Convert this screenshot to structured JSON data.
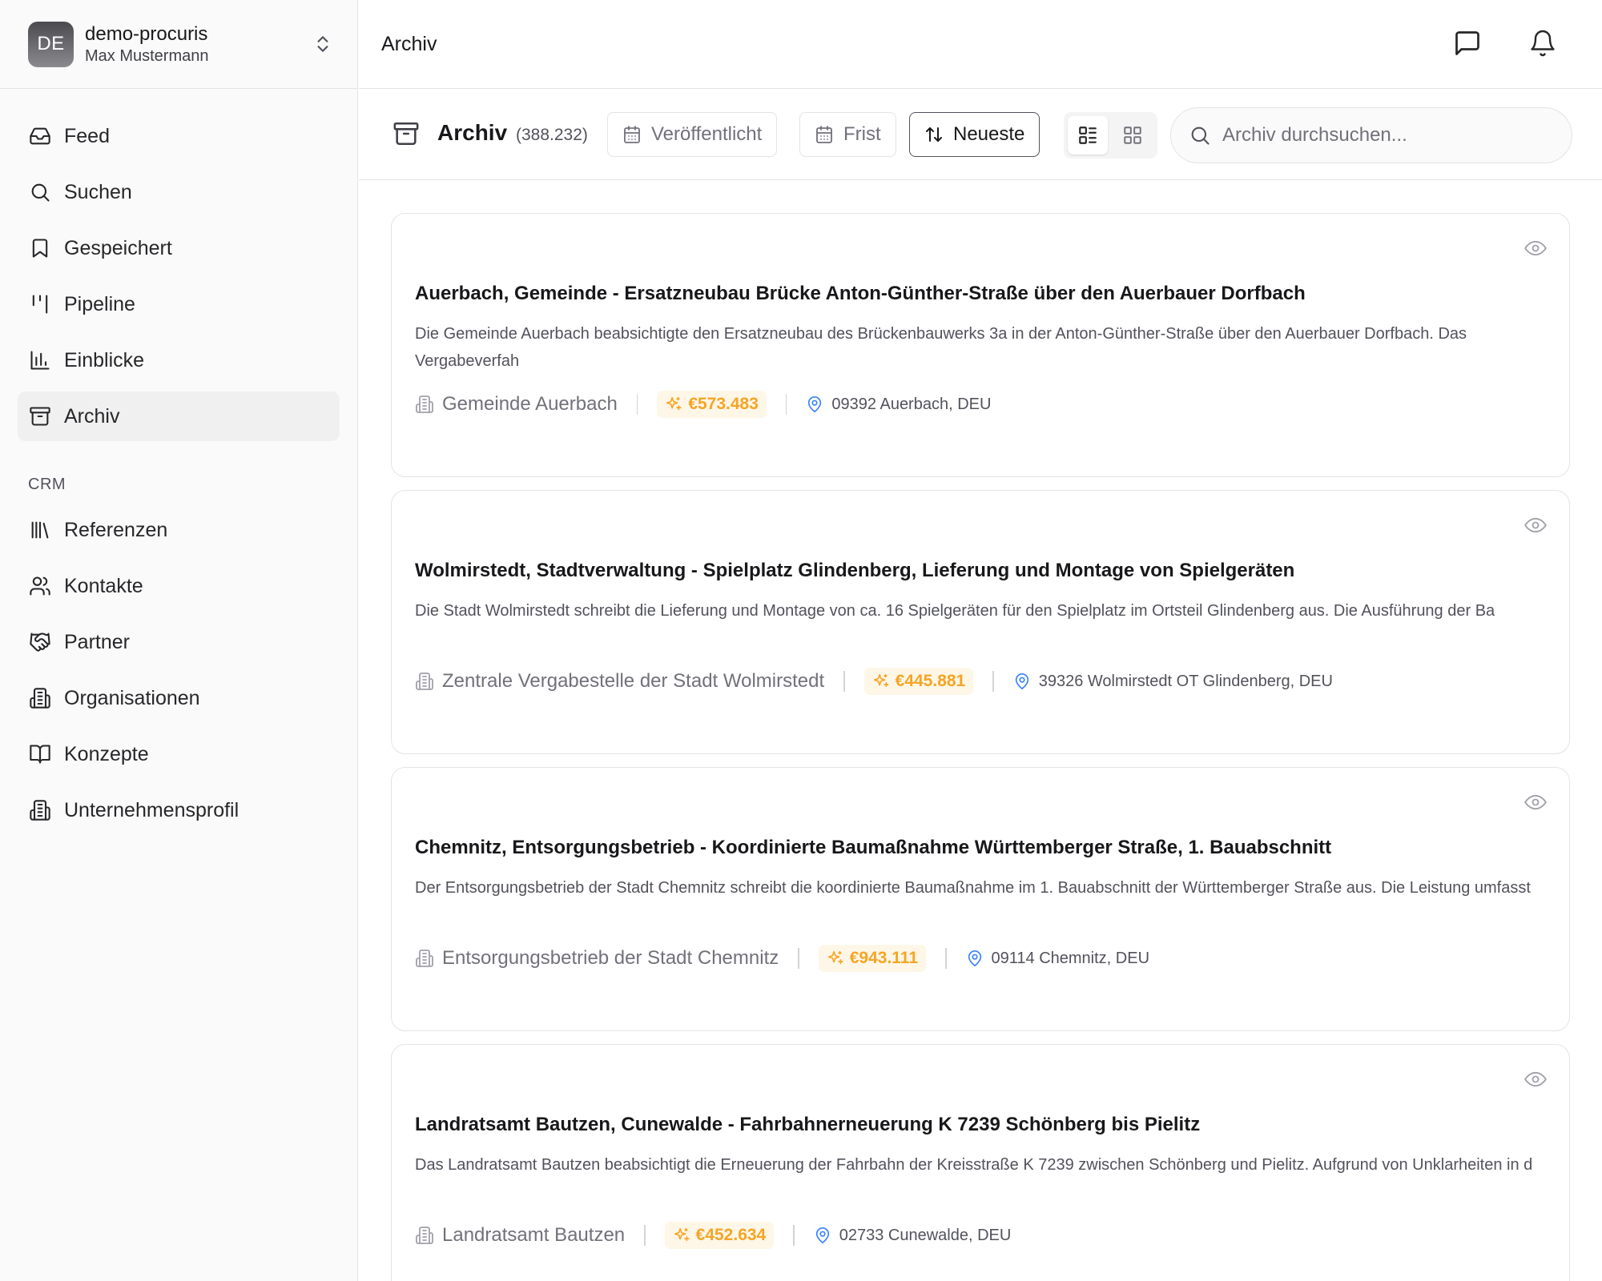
{
  "account": {
    "initials": "DE",
    "workspace": "demo-procuris",
    "user": "Max Mustermann"
  },
  "nav": [
    {
      "label": "Feed",
      "icon": "inbox-icon"
    },
    {
      "label": "Suchen",
      "icon": "search-icon"
    },
    {
      "label": "Gespeichert",
      "icon": "bookmark-icon"
    },
    {
      "label": "Pipeline",
      "icon": "kanban-icon"
    },
    {
      "label": "Einblicke",
      "icon": "bar-chart-icon"
    },
    {
      "label": "Archiv",
      "icon": "archive-icon",
      "active": true
    }
  ],
  "crm": {
    "section_label": "CRM",
    "items": [
      {
        "label": "Referenzen",
        "icon": "library-icon"
      },
      {
        "label": "Kontakte",
        "icon": "users-icon"
      },
      {
        "label": "Partner",
        "icon": "handshake-icon"
      },
      {
        "label": "Organisationen",
        "icon": "building-icon"
      },
      {
        "label": "Konzepte",
        "icon": "book-open-icon"
      },
      {
        "label": "Unternehmensprofil",
        "icon": "building-icon"
      }
    ]
  },
  "topbar": {
    "title": "Archiv",
    "icons": [
      "message-square-icon",
      "bell-icon"
    ]
  },
  "toolbar": {
    "title": "Archiv",
    "count": "(388.232)",
    "published_label": "Veröffentlicht",
    "deadline_label": "Frist",
    "sort_label": "Neueste",
    "view_mode": "list",
    "search_placeholder": "Archiv durchsuchen..."
  },
  "colors": {
    "accent_value": "#f5a524",
    "location_pin": "#3b82f6",
    "active_nav_bg": "#f0f0f1"
  },
  "tenders": [
    {
      "title": "Auerbach, Gemeinde - Ersatzneubau Brücke Anton-Günther-Straße über den Auerbauer Dorfbach",
      "description": "Die Gemeinde Auerbach beabsichtigte den Ersatzneubau des Brückenbauwerks 3a in der Anton-Günther-Straße über den Auerbauer Dorfbach. Das Vergabeverfah",
      "organization": "Gemeinde Auerbach",
      "value": "€573.483",
      "location": "09392 Auerbach, DEU"
    },
    {
      "title": "Wolmirstedt, Stadtverwaltung - Spielplatz Glindenberg, Lieferung und Montage von Spielgeräten",
      "description": "Die Stadt Wolmirstedt schreibt die Lieferung und Montage von ca. 16 Spielgeräten für den Spielplatz im Ortsteil Glindenberg aus. Die Ausführung der Ba",
      "organization": "Zentrale Vergabestelle der Stadt Wolmirstedt",
      "value": "€445.881",
      "location": "39326 Wolmirstedt OT Glindenberg, DEU"
    },
    {
      "title": "Chemnitz, Entsorgungsbetrieb - Koordinierte Baumaßnahme Württemberger Straße, 1. Bauabschnitt",
      "description": "Der Entsorgungsbetrieb der Stadt Chemnitz schreibt die koordinierte Baumaßnahme im 1. Bauabschnitt der Württemberger Straße aus. Die Leistung umfasst",
      "organization": "Entsorgungsbetrieb der Stadt Chemnitz",
      "value": "€943.111",
      "location": "09114 Chemnitz, DEU"
    },
    {
      "title": "Landratsamt Bautzen, Cunewalde - Fahrbahnerneuerung K 7239 Schönberg bis Pielitz",
      "description": "Das Landratsamt Bautzen beabsichtigt die Erneuerung der Fahrbahn der Kreisstraße K 7239 zwischen Schönberg und Pielitz. Aufgrund von Unklarheiten in d",
      "organization": "Landratsamt Bautzen",
      "value": "€452.634",
      "location": "02733 Cunewalde, DEU"
    }
  ]
}
